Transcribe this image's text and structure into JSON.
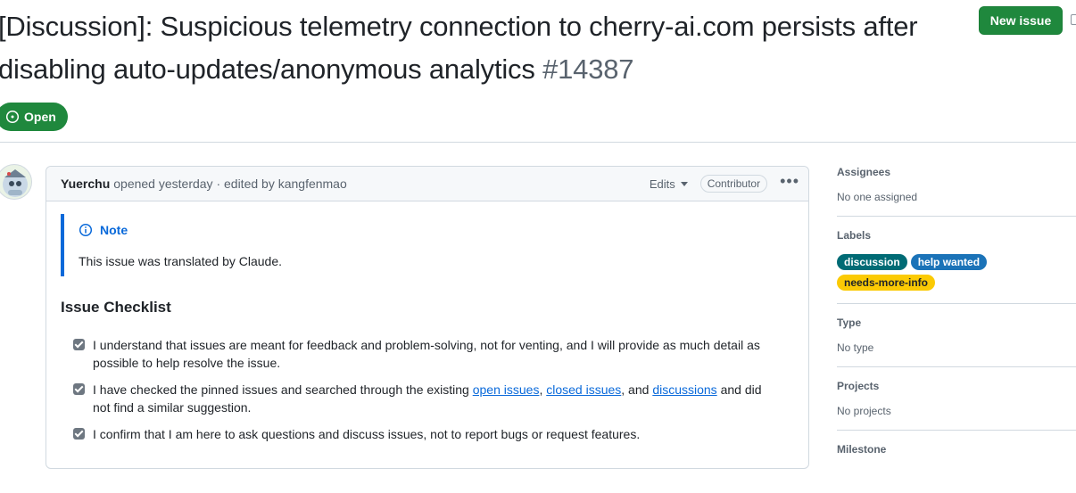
{
  "issue": {
    "title": "[Discussion]: Suspicious telemetry connection to cherry-ai.com persists after disabling auto-updates/anonymous analytics",
    "number": "#14387",
    "state": "Open",
    "new_issue_label": "New issue"
  },
  "comment": {
    "author": "Yuerchu",
    "meta": "opened yesterday · edited by kangfenmao",
    "edits_label": "Edits",
    "role_badge": "Contributor",
    "more_icon": "kebab-horizontal-icon",
    "note_title": "Note",
    "note_body": "This issue was translated by Claude.",
    "checklist_title": "Issue Checklist",
    "checks": [
      {
        "text": "I understand that issues are meant for feedback and problem-solving, not for venting, and I will provide as much detail as possible to help resolve the issue.",
        "checked": true
      },
      {
        "pre": "I have checked the pinned issues and searched through the existing ",
        "link1": "open issues",
        "sep1": ", ",
        "link2": "closed issues",
        "sep2": ", and ",
        "link3": "discussions",
        "post": " and did not find a similar suggestion.",
        "checked": true
      },
      {
        "text": "I confirm that I am here to ask questions and discuss issues, not to report bugs or request features.",
        "checked": true
      }
    ]
  },
  "sidebar": {
    "assignees": {
      "heading": "Assignees",
      "value": "No one assigned"
    },
    "labels": {
      "heading": "Labels",
      "items": [
        "discussion",
        "help wanted",
        "needs-more-info"
      ]
    },
    "type": {
      "heading": "Type",
      "value": "No type"
    },
    "projects": {
      "heading": "Projects",
      "value": "No projects"
    },
    "milestone": {
      "heading": "Milestone"
    }
  },
  "colors": {
    "open_green": "#1f883d",
    "link_blue": "#0969da",
    "label_discussion": "#006b75",
    "label_help": "#1b73b8",
    "label_needs": "#fbca04"
  }
}
